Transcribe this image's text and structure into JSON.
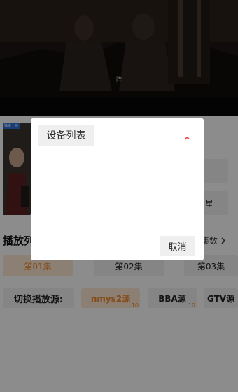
{
  "video": {
    "subtitle": "阵"
  },
  "detail": {
    "poster_tag": "独家上映",
    "button_right_1": "",
    "button_right_2": "星"
  },
  "playlist": {
    "title": "播放列表",
    "count_label": "集数",
    "episodes": [
      "第01集",
      "第02集",
      "第03集"
    ]
  },
  "sources": {
    "label": "切换播放源:",
    "items": [
      {
        "name": "nmys2源",
        "count": "10"
      },
      {
        "name": "BBA源",
        "count": "10"
      },
      {
        "name": "GTV源",
        "count": ""
      }
    ]
  },
  "dialog": {
    "title": "设备列表",
    "cancel_label": "取消"
  },
  "colors": {
    "accent": "#f08a2c",
    "accent_bg": "#ffe9d6",
    "spinner": "#e53935"
  }
}
